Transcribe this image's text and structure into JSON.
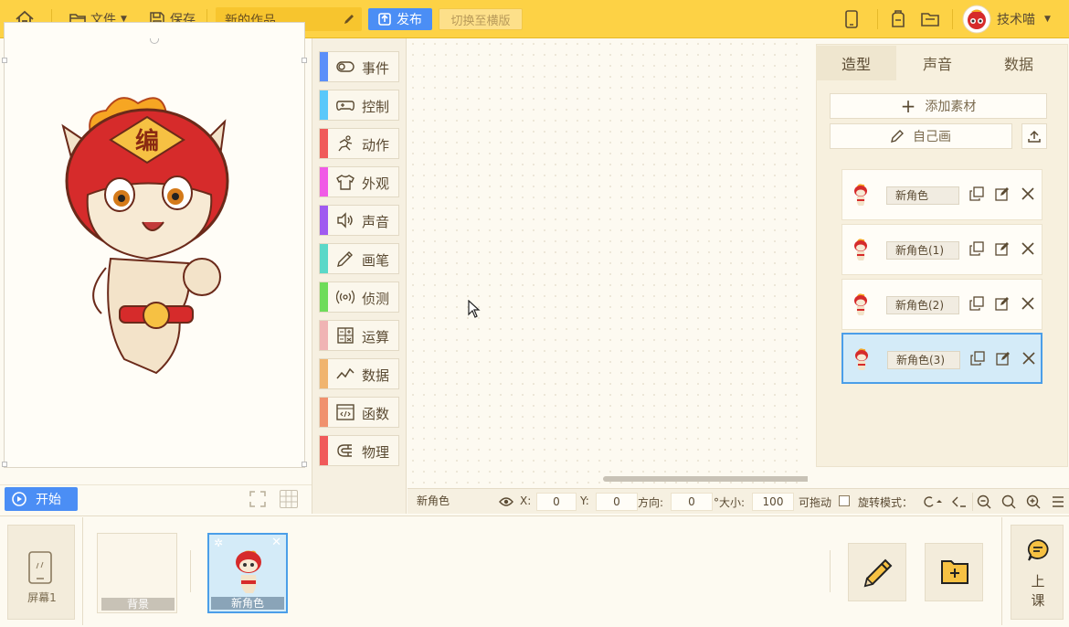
{
  "topbar": {
    "file_label": "文件",
    "save_label": "保存",
    "project_title": "新的作品",
    "publish_label": "发布",
    "landscape_label": "切换至横版",
    "user_name": "技术喵"
  },
  "stage": {
    "start_label": "开始"
  },
  "categories": [
    {
      "label": "事件",
      "color": "#5b8ff9",
      "icon": "toggle-icon"
    },
    {
      "label": "控制",
      "color": "#5ac8fa",
      "icon": "gamepad-icon"
    },
    {
      "label": "动作",
      "color": "#f05a5a",
      "icon": "runner-icon"
    },
    {
      "label": "外观",
      "color": "#f05ae6",
      "icon": "shirt-icon"
    },
    {
      "label": "声音",
      "color": "#a05af0",
      "icon": "speaker-icon"
    },
    {
      "label": "画笔",
      "color": "#5ad8c8",
      "icon": "pen-icon"
    },
    {
      "label": "侦测",
      "color": "#6edc5a",
      "icon": "radar-icon"
    },
    {
      "label": "运算",
      "color": "#f0b4b4",
      "icon": "calculator-icon"
    },
    {
      "label": "数据",
      "color": "#f0b46e",
      "icon": "chart-icon"
    },
    {
      "label": "函数",
      "color": "#f0916e",
      "icon": "code-window-icon"
    },
    {
      "label": "物理",
      "color": "#f05a5a",
      "icon": "magnet-icon"
    }
  ],
  "right_panel": {
    "tabs": [
      {
        "label": "造型",
        "active": true
      },
      {
        "label": "声音",
        "active": false
      },
      {
        "label": "数据",
        "active": false
      }
    ],
    "add_material_label": "添加素材",
    "draw_label": "自己画",
    "costumes": [
      {
        "name": "新角色",
        "selected": false
      },
      {
        "name": "新角色(1)",
        "selected": false
      },
      {
        "name": "新角色(2)",
        "selected": false
      },
      {
        "name": "新角色(3)",
        "selected": true
      }
    ]
  },
  "statusbar": {
    "sprite_name": "新角色",
    "x_label": "X:",
    "x_value": "0",
    "y_label": "Y:",
    "y_value": "0",
    "direction_label": "方向:",
    "direction_value": "0",
    "size_label": "°大小:",
    "size_value": "100",
    "draggable_label": "可拖动",
    "rotation_label": "旋转模式："
  },
  "bottom": {
    "screen_label": "屏幕1",
    "background_label": "背景",
    "sprite_label": "新角色",
    "class_label_1": "上",
    "class_label_2": "课"
  },
  "colors": {
    "topbar": "#fdd245",
    "accent_blue": "#4b8ef5",
    "selected_bg": "#d4ebf8"
  }
}
